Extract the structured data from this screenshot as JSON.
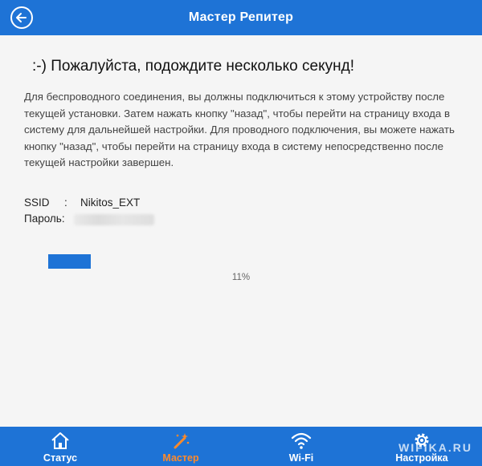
{
  "header": {
    "title": "Мастер Репитер",
    "back_icon": "arrow-left-icon"
  },
  "main": {
    "wait_title": ":-) Пожалуйста, подождите несколько секунд!",
    "description": "Для беспроводного соединения, вы должны подключиться к этому устройству после текущей установки. Затем нажать кнопку \"назад\", чтобы перейти на страницу входа в систему для дальнейшей настройки. Для проводного подключения, вы можете нажать кнопку \"назад\", чтобы перейти на страницу входа в систему непосредственно после текущей настройки завершен.",
    "ssid_label": "SSID",
    "ssid_sep": ":",
    "ssid_value": "Nikitos_EXT",
    "password_label": "Пароль:",
    "progress_text": "11%",
    "progress_value": 0.11
  },
  "nav": {
    "items": [
      {
        "label": "Статус",
        "icon": "home-icon"
      },
      {
        "label": "Мастер",
        "icon": "wand-icon"
      },
      {
        "label": "Wi-Fi",
        "icon": "wifi-icon"
      },
      {
        "label": "Настройка",
        "icon": "gear-icon"
      }
    ]
  },
  "watermark": "WIFIKA.RU",
  "colors": {
    "accent": "#1e73d6",
    "active": "#ff8a2a"
  }
}
